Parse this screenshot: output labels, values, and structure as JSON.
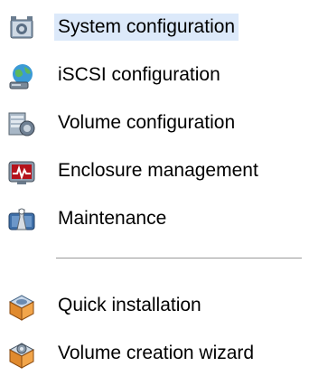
{
  "menu_top": {
    "items": [
      {
        "label": "System configuration",
        "icon": "system-config-icon",
        "selected": true
      },
      {
        "label": "iSCSI configuration",
        "icon": "iscsi-globe-icon",
        "selected": false
      },
      {
        "label": "Volume configuration",
        "icon": "volume-config-icon",
        "selected": false
      },
      {
        "label": "Enclosure management",
        "icon": "enclosure-monitor-icon",
        "selected": false
      },
      {
        "label": "Maintenance",
        "icon": "maintenance-wrench-icon",
        "selected": false
      }
    ]
  },
  "menu_bottom": {
    "items": [
      {
        "label": "Quick installation",
        "icon": "quick-install-box-icon",
        "selected": false
      },
      {
        "label": "Volume creation wizard",
        "icon": "volume-wizard-box-icon",
        "selected": false
      }
    ]
  },
  "colors": {
    "selection_bg": "#dce9fa",
    "divider": "#9a9a9a",
    "text": "#000000"
  }
}
